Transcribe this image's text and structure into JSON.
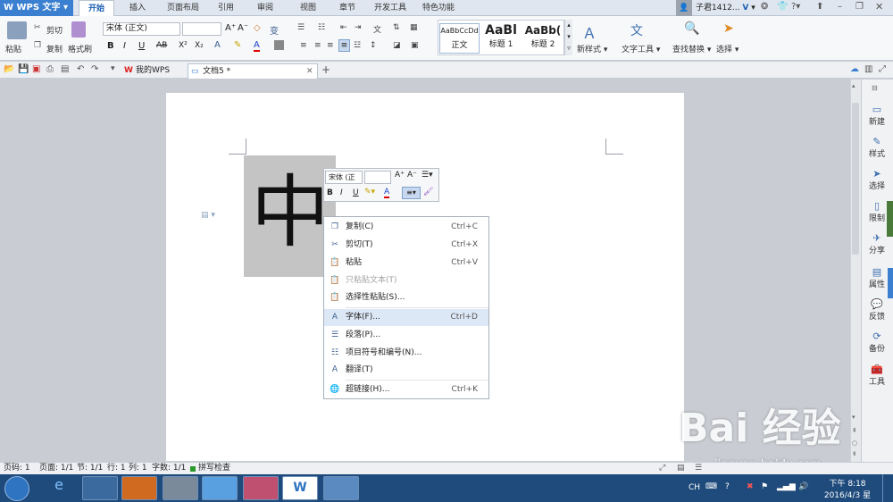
{
  "app": {
    "name": "WPS 文字",
    "user": "子君1412...",
    "user_badge": "V"
  },
  "menu_tabs": [
    {
      "label": "开始",
      "active": true
    },
    {
      "label": "插入"
    },
    {
      "label": "页面布局"
    },
    {
      "label": "引用"
    },
    {
      "label": "审阅"
    },
    {
      "label": "视图"
    },
    {
      "label": "章节"
    },
    {
      "label": "开发工具"
    },
    {
      "label": "特色功能"
    }
  ],
  "ribbon": {
    "paste": "粘贴",
    "cut": "剪切",
    "copy": "复制",
    "format_painter": "格式刷",
    "font_name": "宋体 (正文)",
    "font_size": "",
    "bold": "B",
    "italic": "I",
    "underline": "U",
    "strike": "AB",
    "superscript": "X²",
    "subscript": "X₂",
    "styles": [
      {
        "preview": "AaBbCcDd",
        "name": "正文"
      },
      {
        "preview": "AaBl",
        "name": "标题 1"
      },
      {
        "preview": "AaBb(",
        "name": "标题 2"
      }
    ],
    "new_style": "新样式",
    "text_tools": "文字工具",
    "find_replace": "查找替换",
    "select": "选择"
  },
  "doc_tabs": [
    {
      "label": "我的WPS"
    },
    {
      "label": "文档5 *",
      "active": true
    }
  ],
  "document": {
    "character": "中"
  },
  "mini_toolbar": {
    "font": "宋体 (正",
    "bold": "B",
    "italic": "I",
    "underline": "U",
    "font_color_letter": "A"
  },
  "context_menu": [
    {
      "label": "复制(C)",
      "shortcut": "Ctrl+C",
      "icon": "copy-icon"
    },
    {
      "label": "剪切(T)",
      "shortcut": "Ctrl+X",
      "icon": "scissors-icon"
    },
    {
      "label": "粘贴",
      "shortcut": "Ctrl+V",
      "icon": "paste-icon"
    },
    {
      "label": "只粘贴文本(T)",
      "shortcut": "",
      "icon": "paste-text-icon",
      "disabled": true
    },
    {
      "label": "选择性粘贴(S)...",
      "shortcut": "",
      "icon": "paste-special-icon"
    },
    {
      "label": "字体(F)...",
      "shortcut": "Ctrl+D",
      "icon": "font-icon",
      "highlighted": true
    },
    {
      "label": "段落(P)...",
      "shortcut": "",
      "icon": "paragraph-icon"
    },
    {
      "label": "项目符号和编号(N)...",
      "shortcut": "",
      "icon": "bullets-icon"
    },
    {
      "label": "翻译(T)",
      "shortcut": "",
      "icon": "translate-icon"
    },
    {
      "label": "超链接(H)...",
      "shortcut": "Ctrl+K",
      "icon": "hyperlink-icon"
    }
  ],
  "right_panel": [
    {
      "label": "新建",
      "icon": "new-icon"
    },
    {
      "label": "样式",
      "icon": "style-icon"
    },
    {
      "label": "选择",
      "icon": "select-icon"
    },
    {
      "label": "限制",
      "icon": "restrict-icon"
    },
    {
      "label": "分享",
      "icon": "share-icon"
    },
    {
      "label": "属性",
      "icon": "properties-icon"
    },
    {
      "label": "反馈",
      "icon": "feedback-icon"
    },
    {
      "label": "备份",
      "icon": "backup-icon"
    },
    {
      "label": "工具",
      "icon": "toolbox-icon"
    }
  ],
  "status": {
    "page_code": "页码: 1",
    "pages": "页面: 1/1",
    "section": "节: 1/1",
    "row": "行: 1",
    "col": "列: 1",
    "word_count": "字数: 1/1",
    "spell_check": "拼写检查"
  },
  "taskbar": {
    "lang": "CH",
    "time": "下午 8:18",
    "date": "2016/4/3 星期日"
  },
  "watermark": {
    "text": "Bai  经验",
    "url": "jingyan.baidu.com"
  },
  "colors": {
    "accent": "#3b7fd0",
    "highlight": "#dde8f6",
    "taskbar": "#1f4b7c"
  }
}
